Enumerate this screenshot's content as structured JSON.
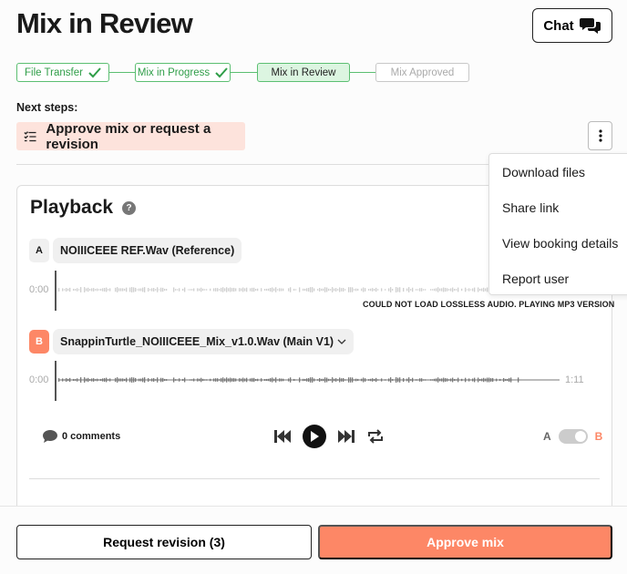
{
  "header": {
    "title": "Mix in Review",
    "chat_label": "Chat"
  },
  "stepper": [
    {
      "label": "File Transfer",
      "state": "done"
    },
    {
      "label": "Mix in Progress",
      "state": "done"
    },
    {
      "label": "Mix in Review",
      "state": "current"
    },
    {
      "label": "Mix Approved",
      "state": "pending"
    }
  ],
  "next_steps": {
    "heading": "Next steps:",
    "item": "Approve mix or request a revision"
  },
  "menu": [
    "Download files",
    "Share link",
    "View booking details",
    "Report user"
  ],
  "playback": {
    "title": "Playback",
    "track_a": {
      "badge": "A",
      "name": "NOIIICEEE REF.Wav (Reference)",
      "start": "0:00"
    },
    "warning": "COULD NOT LOAD LOSSLESS AUDIO. PLAYING MP3 VERSION",
    "track_b": {
      "badge": "B",
      "name": "SnappinTurtle_NOIIICEEE_Mix_v1.0.Wav (Main V1)",
      "start": "0:00",
      "end": "1:11"
    },
    "comments": "0 comments",
    "ab_a": "A",
    "ab_b": "B"
  },
  "actions": {
    "revise": "Request revision (3)",
    "approve": "Approve mix"
  },
  "colors": {
    "accent": "#fd8766",
    "success": "#2f9e48",
    "banner": "#fde3dc"
  }
}
